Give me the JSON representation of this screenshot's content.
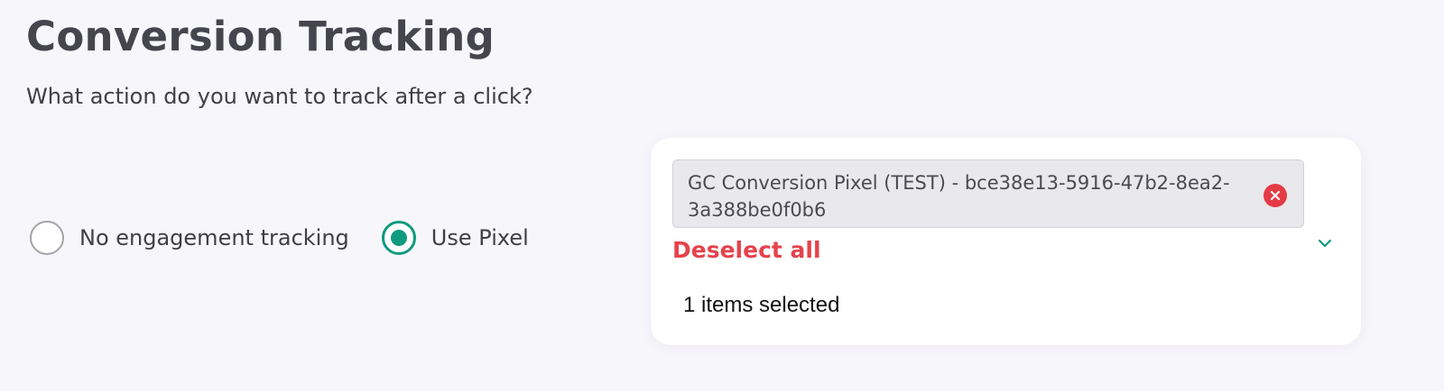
{
  "section": {
    "title": "Conversion Tracking",
    "subtitle": "What action do you want to track after a click?"
  },
  "tracking_options": {
    "selected": "Use Pixel",
    "items": [
      {
        "label": "No engagement tracking",
        "checked": false
      },
      {
        "label": "Use Pixel",
        "checked": true
      }
    ]
  },
  "pixel_select": {
    "chips": [
      {
        "label": "GC Conversion Pixel (TEST) - bce38e13-5916-47b2-8ea2-3a388be0f0b6"
      }
    ],
    "deselect_label": "Deselect all",
    "count_text": "1 items selected",
    "icons": {
      "remove": "close-circle-icon",
      "expand": "chevron-down-icon"
    }
  },
  "colors": {
    "accent": "#0f9a80",
    "danger": "#e5434c",
    "background": "#f7f6fb"
  }
}
